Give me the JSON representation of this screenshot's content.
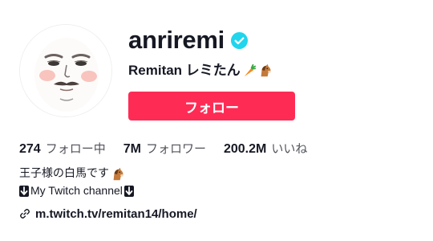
{
  "profile": {
    "username": "anriremi",
    "verified": true,
    "nickname": "Remitan レミたん",
    "nickname_emojis": [
      "carrot-emoji",
      "horse-emoji"
    ],
    "avatar": "face-avatar"
  },
  "actions": {
    "follow_label": "フォロー"
  },
  "stats": [
    {
      "value": "274",
      "label": "フォロー中"
    },
    {
      "value": "7M",
      "label": "フォロワー"
    },
    {
      "value": "200.2M",
      "label": "いいね"
    }
  ],
  "bio": {
    "line1": "王子様の白馬です",
    "line2": "My Twitch channel",
    "link": "m.twitch.tv/remitan14/home/"
  },
  "colors": {
    "accent": "#fe2c55",
    "verified": "#20d5ec",
    "text": "#161823"
  }
}
